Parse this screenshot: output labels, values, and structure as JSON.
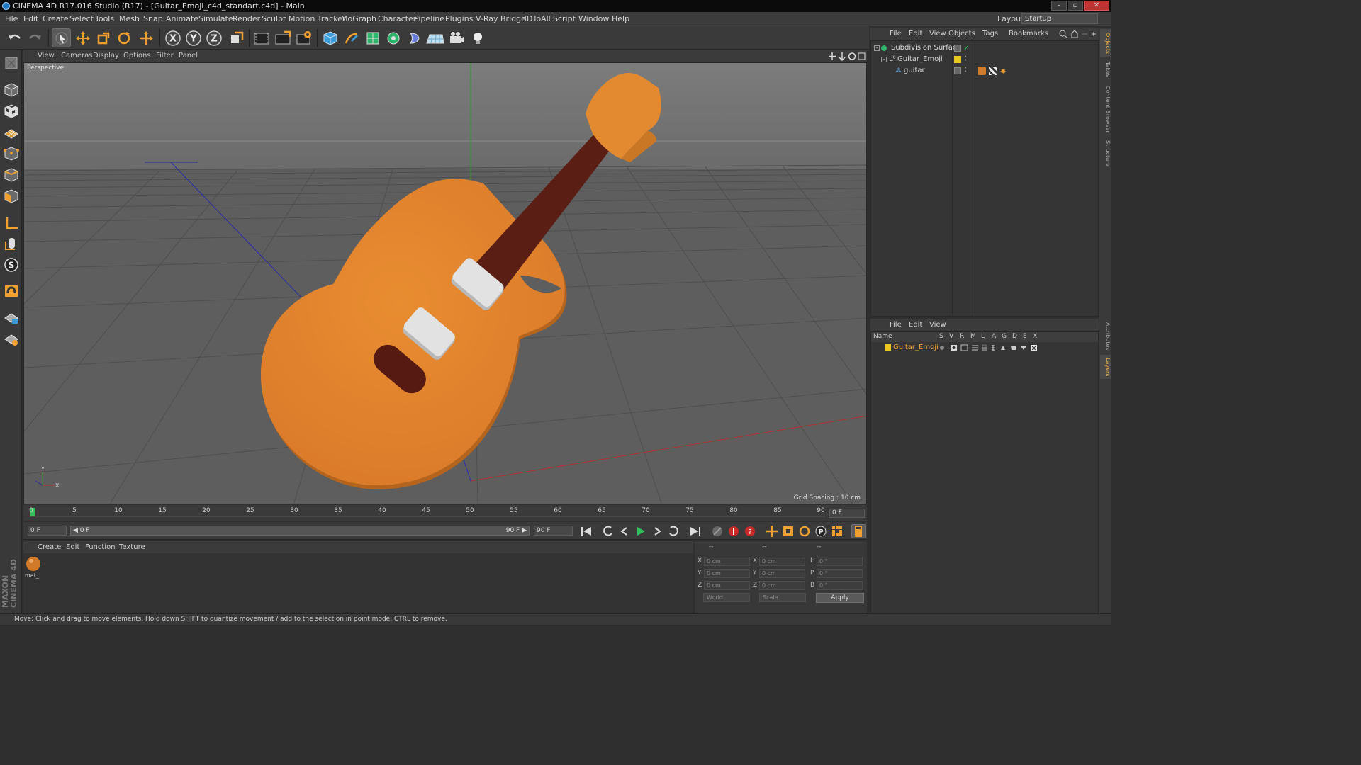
{
  "window": {
    "title": "CINEMA 4D R17.016 Studio (R17) - [Guitar_Emoji_c4d_standart.c4d] - Main",
    "controls": [
      "–",
      "▫",
      "✕"
    ]
  },
  "menu": [
    "File",
    "Edit",
    "Create",
    "Select",
    "Tools",
    "Mesh",
    "Snap",
    "Animate",
    "Simulate",
    "Render",
    "Sculpt",
    "Motion Tracker",
    "MoGraph",
    "Character",
    "Pipeline",
    "Plugins",
    "V-Ray Bridge",
    "3DToAll",
    "Script",
    "Window",
    "Help"
  ],
  "layout": {
    "label": "Layout:",
    "value": "Startup"
  },
  "toolbar": {
    "icons": [
      "undo-icon",
      "redo-icon",
      "select-arrow-icon",
      "move-icon",
      "scale-icon",
      "rotate-icon",
      "transform-icon",
      "x-axis-icon",
      "y-axis-icon",
      "z-axis-icon",
      "coordinate-system-icon",
      "render-view-icon",
      "render-picture-viewer-icon",
      "render-settings-icon",
      "cube-icon",
      "pen-spline-icon",
      "subdivision-icon",
      "array-icon",
      "deformer-icon",
      "floor-icon",
      "camera-icon",
      "light-icon"
    ],
    "axis_labels": [
      "X",
      "Y",
      "Z"
    ]
  },
  "viewport": {
    "menu": [
      "View",
      "Cameras",
      "Display",
      "Options",
      "Filter",
      "Panel"
    ],
    "camera": "Perspective",
    "grid_spacing": "Grid Spacing : 10 cm",
    "axis_labels": {
      "y": "Y",
      "x": "X",
      "z": "Z"
    }
  },
  "timeline": {
    "ticks": [
      "0",
      "5",
      "10",
      "15",
      "20",
      "25",
      "30",
      "35",
      "40",
      "45",
      "50",
      "55",
      "60",
      "65",
      "70",
      "75",
      "80",
      "85",
      "90"
    ],
    "current_frame": "0 F",
    "start_field": "0 F",
    "range_start": "◀ 0 F",
    "range_end": "90 F ▶",
    "end_field": "90 F"
  },
  "materials": {
    "menu": [
      "Create",
      "Edit",
      "Function",
      "Texture"
    ],
    "items": [
      {
        "label": "mat_",
        "color": "#d07a2a"
      }
    ]
  },
  "coordinates": {
    "headers": [
      "--",
      "--",
      "--"
    ],
    "rows": [
      {
        "a": "X",
        "av": "0 cm",
        "b": "X",
        "bv": "0 cm",
        "c": "H",
        "cv": "0 °"
      },
      {
        "a": "Y",
        "av": "0 cm",
        "b": "Y",
        "bv": "0 cm",
        "c": "P",
        "cv": "0 °"
      },
      {
        "a": "Z",
        "av": "0 cm",
        "b": "Z",
        "bv": "0 cm",
        "c": "B",
        "cv": "0 °"
      }
    ],
    "mode1": "World",
    "mode2": "Scale",
    "apply": "Apply"
  },
  "status": "Move: Click and drag to move elements. Hold down SHIFT to quantize movement / add to the selection in point mode, CTRL to remove.",
  "objects": {
    "menu": [
      "File",
      "Edit",
      "View",
      "Objects",
      "Tags",
      "Bookmarks"
    ],
    "items": [
      {
        "name": "Subdivision Surface",
        "indent": 0
      },
      {
        "name": "Guitar_Emoji",
        "indent": 1
      },
      {
        "name": "guitar",
        "indent": 2
      }
    ]
  },
  "layers": {
    "menu": [
      "File",
      "Edit",
      "View"
    ],
    "columns": [
      "Name",
      "S",
      "V",
      "R",
      "M",
      "L",
      "A",
      "G",
      "D",
      "E",
      "X"
    ],
    "items": [
      {
        "name": "Guitar_Emoji",
        "color": "#e8c820"
      }
    ]
  },
  "side_tabs": [
    "Objects",
    "Takes",
    "Content Browser",
    "Structure",
    "Attributes",
    "Layers"
  ],
  "colors": {
    "accent": "#f0a030",
    "guitar_body": "#e0862c",
    "neck": "#5a1e14",
    "pickup": "#dcdcdc"
  }
}
